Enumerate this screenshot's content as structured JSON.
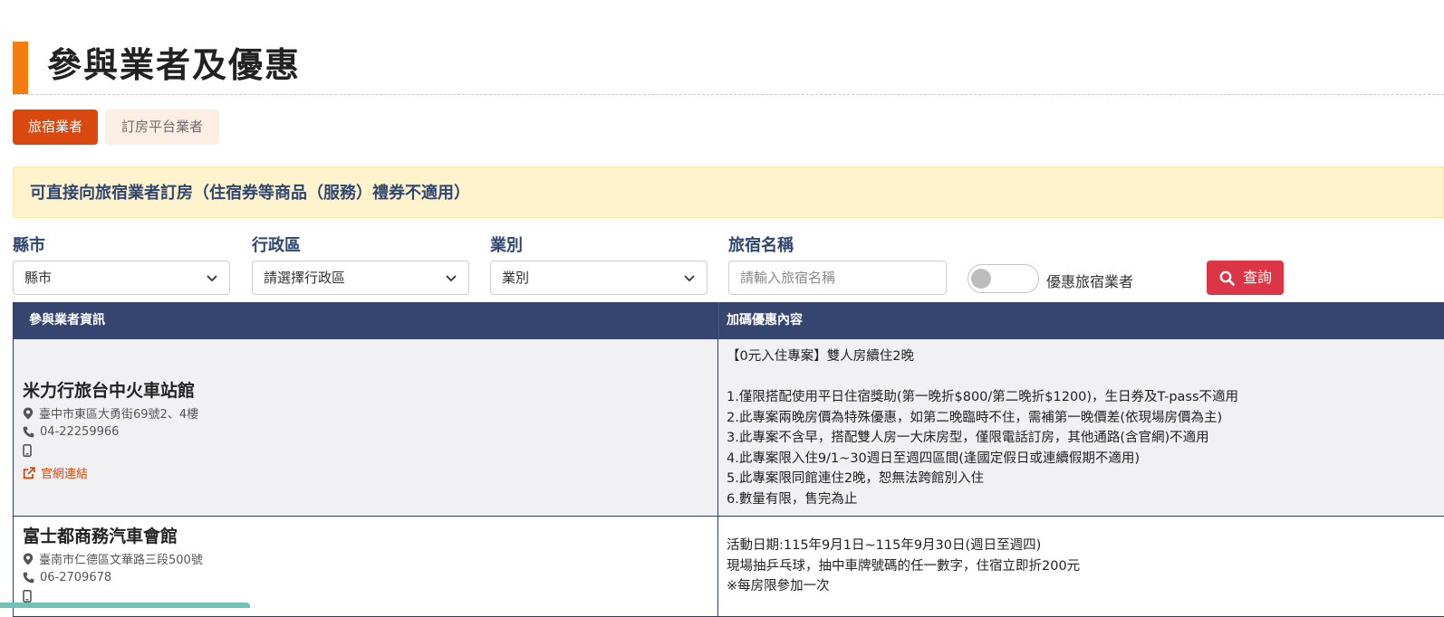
{
  "page": {
    "title": "參與業者及優惠"
  },
  "tabs": [
    {
      "label": "旅宿業者",
      "active": true
    },
    {
      "label": "訂房平台業者",
      "active": false
    }
  ],
  "notice": "可直接向旅宿業者訂房（住宿券等商品（服務）禮券不適用）",
  "filters": {
    "county": {
      "label": "縣市",
      "value": "縣市"
    },
    "district": {
      "label": "行政區",
      "value": "請選擇行政區"
    },
    "category": {
      "label": "業別",
      "value": "業別"
    },
    "name": {
      "label": "旅宿名稱",
      "placeholder": "請輸入旅宿名稱"
    },
    "toggle_label": "優惠旅宿業者",
    "search_label": "查詢"
  },
  "colors": {
    "accent": "#f47c11",
    "active_tab": "#d9480f",
    "header": "#34456f",
    "search_button": "#dc3545",
    "notice_bg": "#fff3cd"
  },
  "table": {
    "headers": [
      "參與業者資訊",
      "加碼優惠內容"
    ],
    "rows": [
      {
        "name": "米力行旅台中火車站館",
        "address": "臺中市東區大勇街69號2、4樓",
        "phone": "04-22259966",
        "mobile": "",
        "website_label": "官網連結",
        "promo_lines": [
          "【0元入住專案】雙人房續住2晚",
          "",
          "1.僅限搭配使用平日住宿獎助(第一晚折$800/第二晚折$1200)，生日券及T-pass不適用",
          "2.此專案兩晚房價為特殊優惠，如第二晚臨時不住，需補第一晚價差(依現場房價為主)",
          "3.此專案不含早，搭配雙人房一大床房型，僅限電話訂房，其他通路(含官網)不適用",
          "4.此專案限入住9/1~30週日至週四區間(逢國定假日或連續假期不適用)",
          "5.此專案限同館連住2晚，恕無法跨館別入住",
          "6.數量有限，售完為止"
        ]
      },
      {
        "name": "富士都商務汽車會館",
        "address": "臺南市仁德區文華路三段500號",
        "phone": "06-2709678",
        "mobile": "",
        "promo_lines": [
          "活動日期:115年9月1日~115年9月30日(週日至週四)",
          "現場抽乒乓球，抽中車牌號碼的任一數字，住宿立即折200元",
          "※每房限參加一次"
        ]
      }
    ]
  },
  "icons": [
    "map-pin-icon",
    "phone-icon",
    "mobile-icon",
    "external-link-icon",
    "search-icon",
    "chevron-down-icon"
  ]
}
